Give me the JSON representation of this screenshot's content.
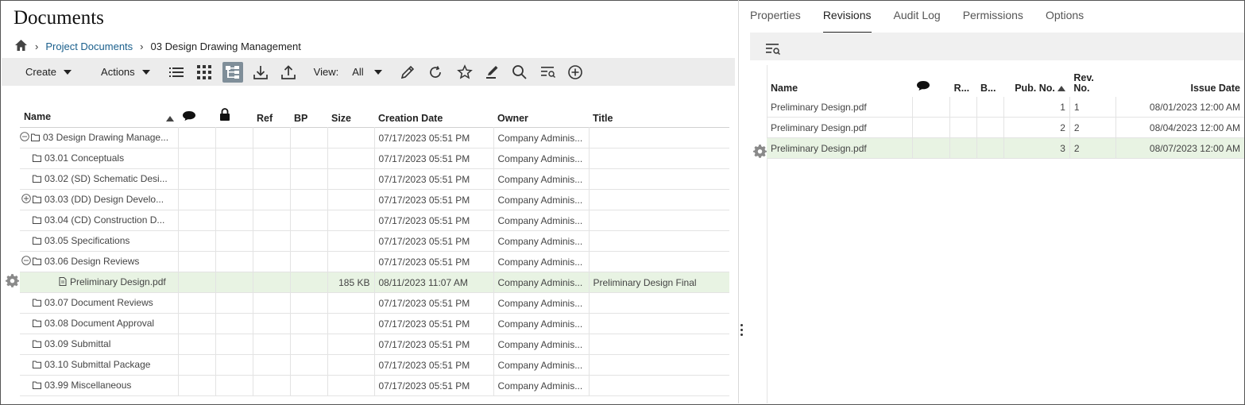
{
  "page": {
    "title": "Documents"
  },
  "breadcrumb": {
    "items": [
      "Project Documents",
      "03 Design Drawing Management"
    ]
  },
  "toolbar": {
    "create_label": "Create",
    "actions_label": "Actions",
    "view_label": "View:",
    "view_value": "All"
  },
  "docs": {
    "columns": [
      "Name",
      "",
      "",
      "Ref",
      "BP",
      "Size",
      "Creation Date",
      "Owner",
      "Title"
    ],
    "rows": [
      {
        "name": "03 Design Drawing Manage...",
        "size": "",
        "date": "07/17/2023 05:51 PM",
        "owner": "Company Adminis...",
        "title": ""
      },
      {
        "name": "03.01 Conceptuals",
        "size": "",
        "date": "07/17/2023 05:51 PM",
        "owner": "Company Adminis...",
        "title": ""
      },
      {
        "name": "03.02 (SD) Schematic Desi...",
        "size": "",
        "date": "07/17/2023 05:51 PM",
        "owner": "Company Adminis...",
        "title": ""
      },
      {
        "name": "03.03 (DD) Design Develo...",
        "size": "",
        "date": "07/17/2023 05:51 PM",
        "owner": "Company Adminis...",
        "title": ""
      },
      {
        "name": "03.04 (CD) Construction D...",
        "size": "",
        "date": "07/17/2023 05:51 PM",
        "owner": "Company Adminis...",
        "title": ""
      },
      {
        "name": "03.05 Specifications",
        "size": "",
        "date": "07/17/2023 05:51 PM",
        "owner": "Company Adminis...",
        "title": ""
      },
      {
        "name": "03.06 Design Reviews",
        "size": "",
        "date": "07/17/2023 05:51 PM",
        "owner": "Company Adminis...",
        "title": ""
      },
      {
        "name": "Preliminary Design.pdf",
        "size": "185 KB",
        "date": "08/11/2023 11:07 AM",
        "owner": "Company Adminis...",
        "title": "Preliminary Design Final"
      },
      {
        "name": "03.07 Document Reviews",
        "size": "",
        "date": "07/17/2023 05:51 PM",
        "owner": "Company Adminis...",
        "title": ""
      },
      {
        "name": "03.08 Document Approval",
        "size": "",
        "date": "07/17/2023 05:51 PM",
        "owner": "Company Adminis...",
        "title": ""
      },
      {
        "name": "03.09 Submittal",
        "size": "",
        "date": "07/17/2023 05:51 PM",
        "owner": "Company Adminis...",
        "title": ""
      },
      {
        "name": "03.10 Submittal Package",
        "size": "",
        "date": "07/17/2023 05:51 PM",
        "owner": "Company Adminis...",
        "title": ""
      },
      {
        "name": "03.99 Miscellaneous",
        "size": "",
        "date": "07/17/2023 05:51 PM",
        "owner": "Company Adminis...",
        "title": ""
      }
    ]
  },
  "right": {
    "tabs": [
      "Properties",
      "Revisions",
      "Audit Log",
      "Permissions",
      "Options"
    ],
    "columns": [
      "Name",
      "",
      "R...",
      "B...",
      "Pub. No.",
      "Rev. No.",
      "Issue Date"
    ],
    "rows": [
      {
        "name": "Preliminary Design.pdf",
        "pub": "1",
        "rev": "1",
        "date": "08/01/2023 12:00 AM"
      },
      {
        "name": "Preliminary Design.pdf",
        "pub": "2",
        "rev": "2",
        "date": "08/04/2023 12:00 AM"
      },
      {
        "name": "Preliminary Design.pdf",
        "pub": "3",
        "rev": "2",
        "date": "08/07/2023 12:00 AM"
      }
    ]
  },
  "icons": {
    "home": "home-icon",
    "list_view": "list-view-icon",
    "grid_view": "grid-view-icon",
    "tree_view": "tree-view-icon",
    "download": "download-icon",
    "upload": "upload-icon",
    "edit": "pencil-icon",
    "refresh": "refresh-icon",
    "favorite": "star-icon",
    "markup": "markup-pen-icon",
    "search": "search-icon",
    "filter": "filter-search-icon",
    "add": "add-circle-icon",
    "gear": "gear-icon",
    "comment": "comment-icon",
    "lock": "lock-icon"
  },
  "colors": {
    "accent_link": "#1a5f8c",
    "selected_row": "#e8f3e3",
    "toolbar_bg": "#ececec",
    "active_tool": "#7f8e99"
  }
}
